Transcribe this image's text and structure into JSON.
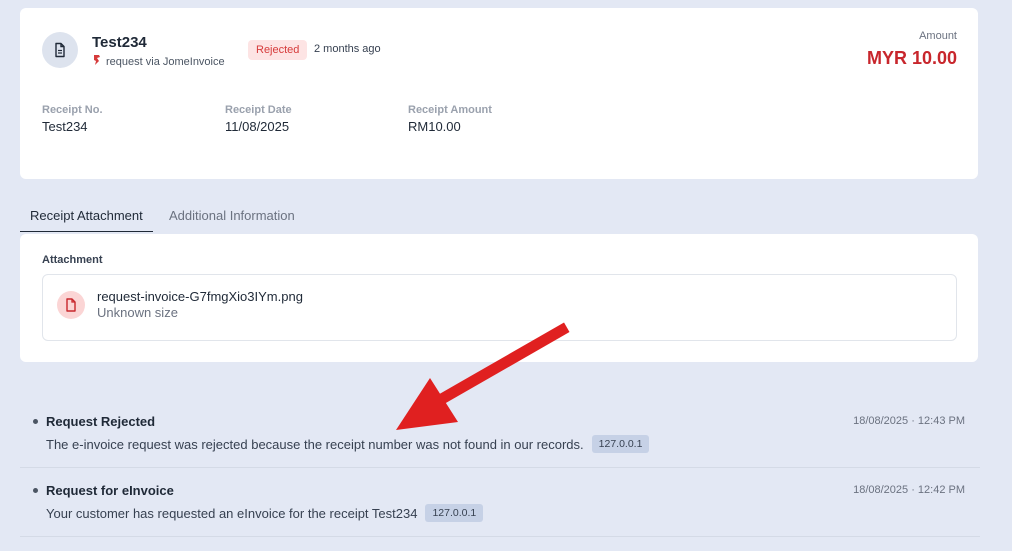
{
  "receipt": {
    "title": "Test234",
    "source": "request via JomeInvoice",
    "status": "Rejected",
    "time_ago": "2 months ago",
    "amount_label": "Amount",
    "amount_value": "MYR 10.00",
    "fields": [
      {
        "label": "Receipt No.",
        "value": "Test234"
      },
      {
        "label": "Receipt Date",
        "value": "11/08/2025"
      },
      {
        "label": "Receipt Amount",
        "value": "RM10.00"
      }
    ]
  },
  "tabs": [
    {
      "label": "Receipt Attachment",
      "active": true
    },
    {
      "label": "Additional Information",
      "active": false
    }
  ],
  "attachment": {
    "section_label": "Attachment",
    "file_name": "request-invoice-G7fmgXio3IYm.png",
    "file_size": "Unknown size"
  },
  "activity": [
    {
      "title": "Request Rejected",
      "description": "The e-invoice request was rejected because the receipt number was not found in our records.",
      "ip": "127.0.0.1",
      "timestamp": "18/08/2025 · 12:43 PM"
    },
    {
      "title": "Request for eInvoice",
      "description": "Your customer has requested an eInvoice for the receipt Test234",
      "ip": "127.0.0.1",
      "timestamp": "18/08/2025 · 12:42 PM"
    }
  ],
  "colors": {
    "background": "#e3e8f4",
    "accent_red": "#c8262c",
    "badge_bg": "#fde4e4",
    "annotation_arrow": "#e02020"
  },
  "icons": [
    "document-icon",
    "jomeinvoice-logo-icon",
    "file-pdf-icon",
    "bullet-icon"
  ]
}
